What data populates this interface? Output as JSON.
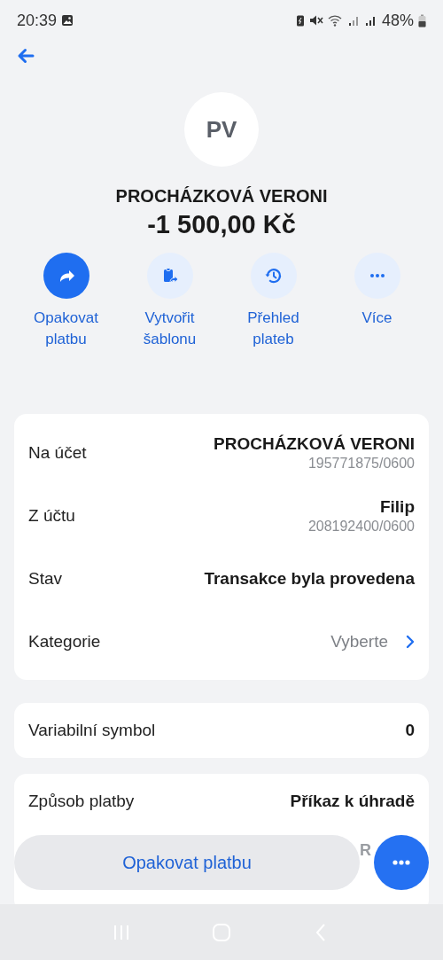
{
  "status_bar": {
    "time": "20:39",
    "battery": "48%"
  },
  "header": {
    "initials": "PV",
    "name": "PROCHÁZKOVÁ VERONI",
    "amount": "-1 500,00 Kč"
  },
  "actions": [
    {
      "kind": "repeat",
      "label": "Opakovat platbu",
      "primary": true
    },
    {
      "kind": "template",
      "label": "Vytvořit šablonu",
      "primary": false
    },
    {
      "kind": "history",
      "label": "Přehled plateb",
      "primary": false
    },
    {
      "kind": "more",
      "label": "Více",
      "primary": false
    }
  ],
  "cards": [
    {
      "rows": [
        {
          "kind": "account",
          "label": "Na účet",
          "value": "PROCHÁZKOVÁ VERONI",
          "sub": "195771875/0600"
        },
        {
          "kind": "account",
          "label": "Z účtu",
          "value": "Filip",
          "sub": "208192400/0600"
        },
        {
          "kind": "plain",
          "label": "Stav",
          "value": "Transakce byla provedena"
        },
        {
          "kind": "link",
          "label": "Kategorie",
          "placeholder": "Vyberte"
        }
      ]
    },
    {
      "rows": [
        {
          "kind": "plain",
          "label": "Variabilní symbol",
          "value": "0"
        }
      ]
    },
    {
      "rows": [
        {
          "kind": "plain",
          "label": "Způsob platby",
          "value": "Příkaz k úhradě"
        },
        {
          "kind": "faded",
          "value": "R"
        }
      ]
    }
  ],
  "bottom_button": {
    "label": "Opakovat platbu"
  }
}
